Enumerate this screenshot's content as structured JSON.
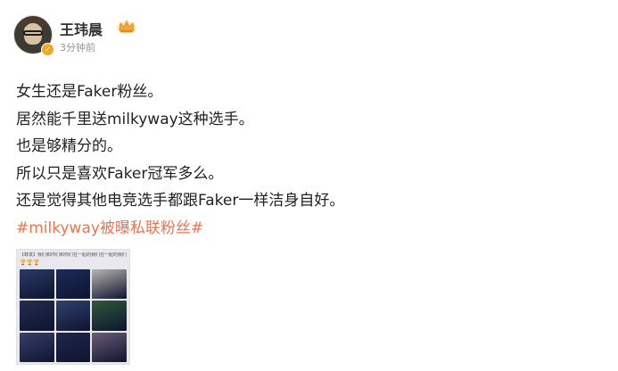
{
  "header": {
    "username": "王玮晨",
    "timestamp": "3分钟前",
    "avatar_icon": "user-avatar",
    "badge_icon": "vip-crown-icon",
    "verify_icon": "verified-icon"
  },
  "post": {
    "lines": [
      "女生还是Faker粉丝。",
      "居然能千里送milkyway这种选手。",
      "也是够精分的。",
      "所以只是喜欢Faker冠军多么。",
      "还是觉得其他电竞选手都跟Faker一样洁身自好。"
    ],
    "hashtag": "#milkyway被曝私联粉丝#"
  },
  "image": {
    "caption": "【转发】我们和你们和你们在一起的我们在一起的我们在一起",
    "trophies": "🏆🏆🏆",
    "cells": [
      {
        "color": "#2b3a66"
      },
      {
        "color": "#1d2b5a"
      },
      {
        "color": "#b9b6b0"
      },
      {
        "color": "#232c4f"
      },
      {
        "color": "#31416e"
      },
      {
        "color": "#2f5a3a"
      },
      {
        "color": "#3a3f6b"
      },
      {
        "color": "#20264a"
      },
      {
        "color": "#6c5d78"
      }
    ]
  },
  "colors": {
    "hashtag": "#eb7350",
    "timestamp": "#939393",
    "badge": "#f5a623"
  }
}
